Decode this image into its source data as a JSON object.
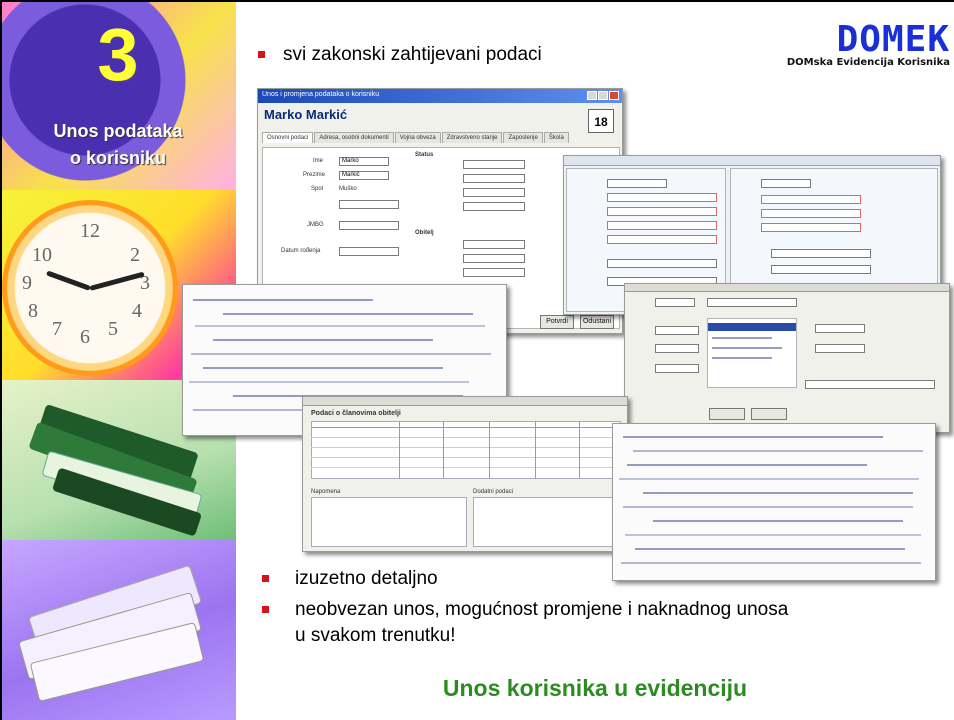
{
  "sidebar": {
    "number": "3",
    "title_line1": "Unos podataka",
    "title_line2": "o korisniku"
  },
  "logo": {
    "word": "DOMEK",
    "subtitle": "DOMska Evidencija Korisnika"
  },
  "bullets_top": [
    "svi zakonski zahtijevani podaci"
  ],
  "bullets_bottom": [
    "izuzetno detaljno",
    "neobvezan unos, mogućnost promjene i naknadnog unosa",
    "u svakom trenutku!"
  ],
  "tagline": "Unos korisnika u evidenciju",
  "main_window": {
    "title": "Unos i promjena podataka o korisniku",
    "person_name": "Marko Markić",
    "tabs": [
      "Osnovni podaci",
      "Adresa, osobni dokumenti",
      "Vojna obveza",
      "Zdravstveno stanje",
      "Zaposlenje",
      "Škola"
    ],
    "labels": {
      "ime": "Ime",
      "prezime": "Prezime",
      "spol": "Spol",
      "jmbg": "JMBG",
      "datum": "Datum rođenja",
      "status": "Status",
      "obitelj": "Obitelj"
    },
    "values": {
      "ime": "Marko",
      "prezime": "Markić",
      "spol": "Muško"
    },
    "buttons": {
      "ok": "Potvrdi",
      "cancel": "Odustani"
    }
  },
  "grid_window": {
    "title": "Podaci o članovima obitelji",
    "notes_label": "Napomena",
    "extra_label": "Dodatni podaci"
  }
}
